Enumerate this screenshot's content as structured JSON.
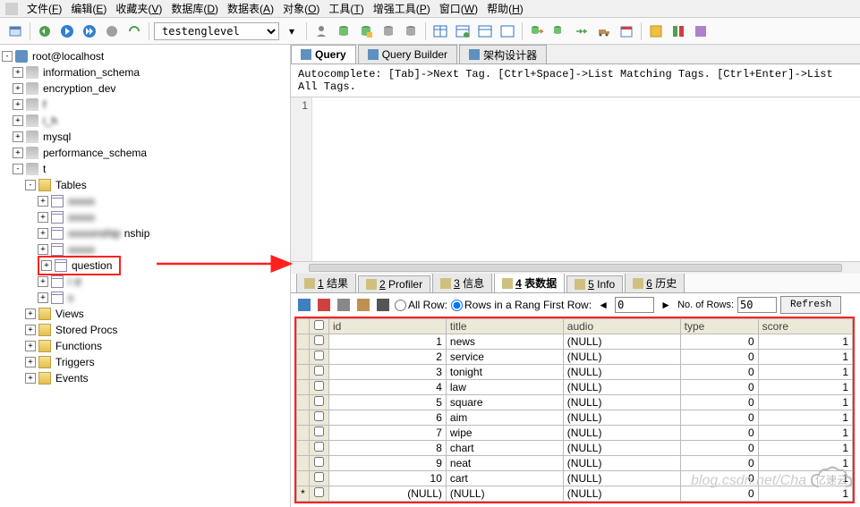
{
  "menu": {
    "items": [
      {
        "t": "文件",
        "u": "F"
      },
      {
        "t": "编辑",
        "u": "E"
      },
      {
        "t": "收藏夹",
        "u": "V"
      },
      {
        "t": "数据库",
        "u": "D"
      },
      {
        "t": "数据表",
        "u": "A"
      },
      {
        "t": "对象",
        "u": "O"
      },
      {
        "t": "工具",
        "u": "T"
      },
      {
        "t": "增强工具",
        "u": "P"
      },
      {
        "t": "窗口",
        "u": "W"
      },
      {
        "t": "帮助",
        "u": "H"
      }
    ]
  },
  "toolbar": {
    "db_selected": "testenglevel"
  },
  "tree": {
    "root": "root@localhost",
    "dbs": [
      {
        "n": "information_schema"
      },
      {
        "n": "encryption_dev"
      },
      {
        "n": "f",
        "blur": true
      },
      {
        "n": "i",
        "blur": true,
        "suffix": "_h"
      },
      {
        "n": "mysql"
      },
      {
        "n": "performance_schema"
      }
    ],
    "active_db": "t",
    "tables_label": "Tables",
    "tables": [
      {
        "n": "",
        "blur": true
      },
      {
        "n": "",
        "blur": true
      },
      {
        "n": "",
        "blur": true,
        "suffix": "nship"
      },
      {
        "n": "",
        "blur": true
      }
    ],
    "highlighted_table": "question",
    "tables_after": [
      {
        "n": "r      d",
        "blur": true
      },
      {
        "n": "s",
        "blur": true
      }
    ],
    "folders": [
      "Views",
      "Stored Procs",
      "Functions",
      "Triggers",
      "Events"
    ]
  },
  "editor": {
    "tabs": [
      {
        "label": "Query",
        "active": true,
        "icon": "query-icon"
      },
      {
        "label": "Query Builder",
        "active": false,
        "icon": "builder-icon"
      },
      {
        "label": "架构设计器",
        "active": false,
        "icon": "schema-icon"
      }
    ],
    "autocomplete_hint": "Autocomplete: [Tab]->Next Tag. [Ctrl+Space]->List Matching Tags. [Ctrl+Enter]->List All Tags.",
    "line_no": "1"
  },
  "result": {
    "tabs": [
      {
        "i": "1",
        "label": "1 结果",
        "icon": "result-icon"
      },
      {
        "i": "2",
        "label": "2 Profiler",
        "icon": "profiler-icon"
      },
      {
        "i": "3",
        "label": "3 信息",
        "icon": "info-icon"
      },
      {
        "i": "4",
        "label": "4 表数据",
        "icon": "tabledata-icon",
        "active": true
      },
      {
        "i": "5",
        "label": "5 Info",
        "icon": "info2-icon"
      },
      {
        "i": "6",
        "label": "6 历史",
        "icon": "history-icon"
      }
    ],
    "toolbar": {
      "all_rows": "All Row:",
      "rows_range": "Rows in a Rang First Row:",
      "first_row_val": "0",
      "num_rows_label": "No. of Rows:",
      "num_rows_val": "50",
      "refresh": "Refresh"
    },
    "columns": [
      "",
      "",
      "id",
      "title",
      "audio",
      "type",
      "score"
    ],
    "rows": [
      {
        "id": "1",
        "title": "news",
        "audio": "(NULL)",
        "type": "0",
        "score": "1"
      },
      {
        "id": "2",
        "title": "service",
        "audio": "(NULL)",
        "type": "0",
        "score": "1"
      },
      {
        "id": "3",
        "title": "tonight",
        "audio": "(NULL)",
        "type": "0",
        "score": "1"
      },
      {
        "id": "4",
        "title": "law",
        "audio": "(NULL)",
        "type": "0",
        "score": "1"
      },
      {
        "id": "5",
        "title": "square",
        "audio": "(NULL)",
        "type": "0",
        "score": "1"
      },
      {
        "id": "6",
        "title": "aim",
        "audio": "(NULL)",
        "type": "0",
        "score": "1"
      },
      {
        "id": "7",
        "title": "wipe",
        "audio": "(NULL)",
        "type": "0",
        "score": "1"
      },
      {
        "id": "8",
        "title": "chart",
        "audio": "(NULL)",
        "type": "0",
        "score": "1"
      },
      {
        "id": "9",
        "title": "neat",
        "audio": "(NULL)",
        "type": "0",
        "score": "1"
      },
      {
        "id": "10",
        "title": "cart",
        "audio": "(NULL)",
        "type": "0",
        "score": "1"
      }
    ],
    "new_row": {
      "id": "(NULL)",
      "title": "(NULL)",
      "audio": "(NULL)",
      "type": "0",
      "score": "1"
    }
  },
  "watermark": "blog.csdn.net/Cha",
  "logo_text": "亿速云"
}
